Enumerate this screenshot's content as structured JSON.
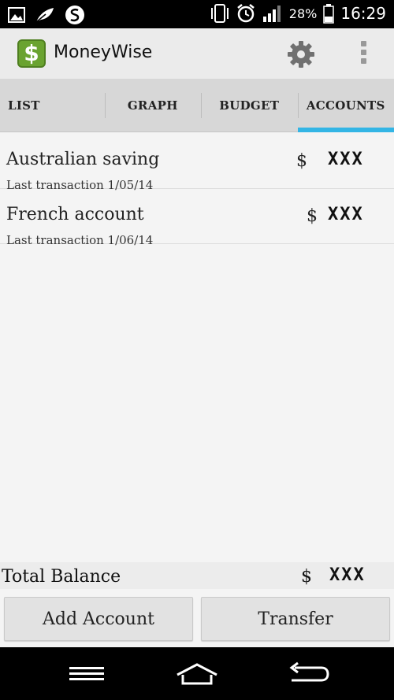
{
  "status_bar": {
    "battery": "28%",
    "time": "16:29",
    "icons": [
      "gallery-icon",
      "feather-icon",
      "s-sync-icon",
      "vibrate-icon",
      "alarm-icon",
      "signal-icon",
      "battery-icon"
    ]
  },
  "app": {
    "logo_glyph": "$",
    "title": "MoneyWise",
    "accent": "#33b5e5",
    "logo_color": "#6aa330"
  },
  "tabs": [
    {
      "label": "LIST",
      "active": false
    },
    {
      "label": "GRAPH",
      "active": false
    },
    {
      "label": "BUDGET",
      "active": false
    },
    {
      "label": "ACCOUNTS",
      "active": true
    }
  ],
  "accounts": [
    {
      "name": "Australian saving",
      "last_transaction": "Last transaction 1/05/14",
      "currency": "$",
      "amount": "XXX"
    },
    {
      "name": "French account",
      "last_transaction": "Last transaction 1/06/14",
      "currency": "$",
      "amount": "XXX"
    }
  ],
  "total": {
    "label": "Total Balance",
    "currency": "$",
    "amount": "XXX"
  },
  "buttons": {
    "add_account": "Add Account",
    "transfer": "Transfer"
  },
  "nav": {
    "icons": [
      "menu-icon",
      "home-icon",
      "back-icon"
    ]
  }
}
